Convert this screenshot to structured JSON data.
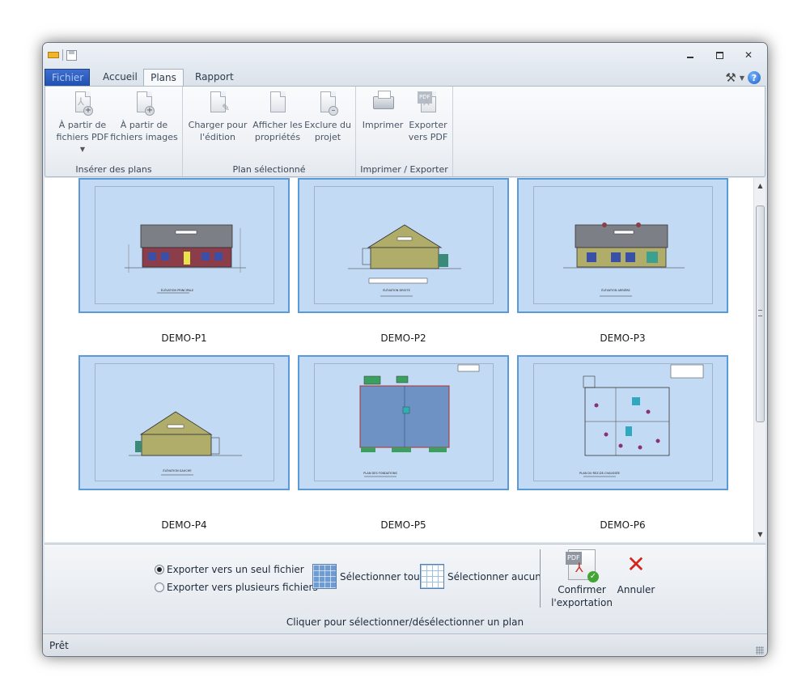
{
  "tabs": {
    "file": "Fichier",
    "home": "Accueil",
    "plans": "Plans",
    "report": "Rapport"
  },
  "ribbon": {
    "insert": {
      "group_label": "Insérer des plans",
      "from_pdf": "À partir de fichiers PDF",
      "from_images": "À partir de fichiers images"
    },
    "selected": {
      "group_label": "Plan sélectionné",
      "load": "Charger pour l'édition",
      "properties": "Afficher les propriétés",
      "exclude": "Exclure du projet"
    },
    "print_export": {
      "group_label": "Imprimer / Exporter",
      "print": "Imprimer",
      "export_pdf": "Exporter vers PDF"
    }
  },
  "plans": [
    {
      "name": "DEMO-P1",
      "caption": "ÉLÉVATION PRINCIPALE"
    },
    {
      "name": "DEMO-P2",
      "caption": "ÉLÉVATION DROITE"
    },
    {
      "name": "DEMO-P3",
      "caption": "ÉLÉVATION ARRIÈRE"
    },
    {
      "name": "DEMO-P4",
      "caption": "ÉLÉVATION GAUCHE"
    },
    {
      "name": "DEMO-P5",
      "caption": "PLAN DES FONDATIONS"
    },
    {
      "name": "DEMO-P6",
      "caption": "PLAN DU REZ-DE-CHAUSSÉE"
    }
  ],
  "export": {
    "single_file": "Exporter vers un seul fichier",
    "multiple_files": "Exporter vers plusieurs fichiers",
    "select_all": "Sélectionner tout",
    "select_none": "Sélectionner aucun",
    "confirm": "Confirmer l'exportation",
    "cancel": "Annuler",
    "hint": "Cliquer pour sélectionner/désélectionner un plan"
  },
  "status": "Prêt"
}
